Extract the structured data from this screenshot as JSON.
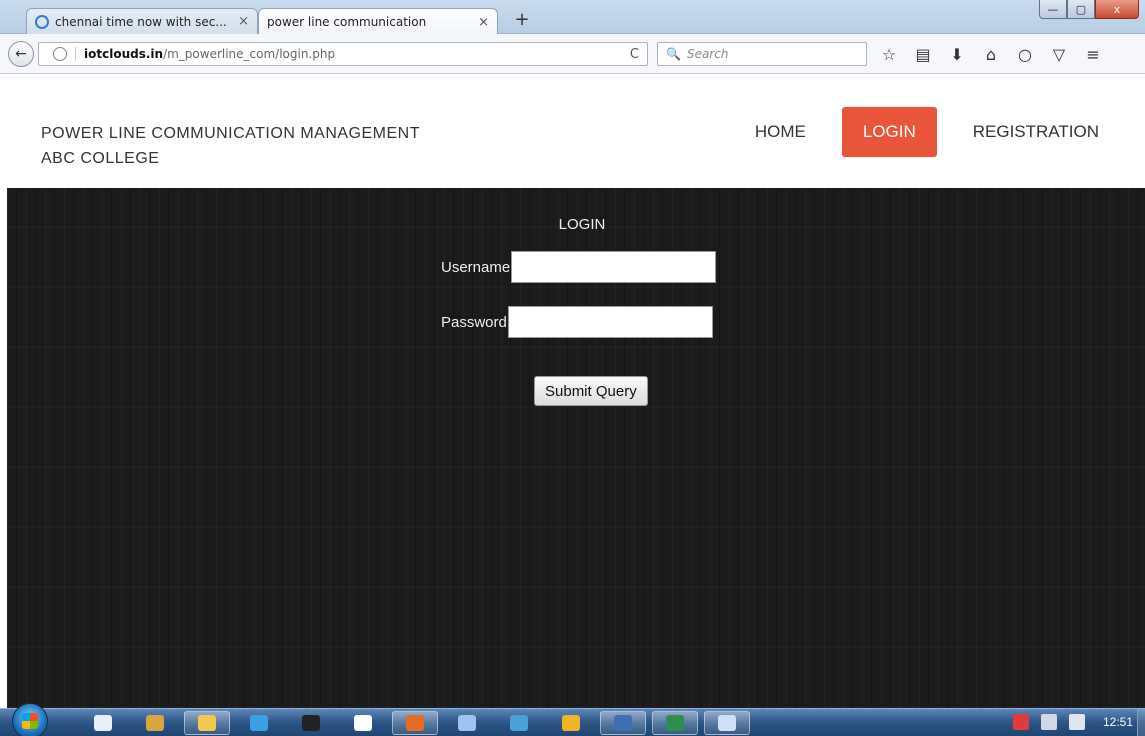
{
  "browser": {
    "tabs": [
      {
        "title": "chennai time now with sec...",
        "close": "×"
      },
      {
        "title": "power line communication",
        "close": "×"
      }
    ],
    "new_tab": "+",
    "window_controls": {
      "minimize": "—",
      "maximize": "▢",
      "close": "x"
    },
    "back": "←",
    "url_host": "iotclouds.in",
    "url_path": "/m_powerline_com/login.php",
    "reload": "C",
    "search_placeholder": "Search",
    "search_icon": "🔍",
    "toolbar_icons": [
      "star-icon",
      "reading-list-icon",
      "download-icon",
      "home-icon",
      "chat-icon",
      "pocket-icon",
      "menu-icon"
    ],
    "toolbar_glyphs": [
      "☆",
      "▤",
      "⬇",
      "⌂",
      "○",
      "▽",
      "≡"
    ]
  },
  "site": {
    "title_line1": "POWER LINE COMMUNICATION MANAGEMENT",
    "title_line2": "ABC COLLEGE",
    "nav": [
      {
        "label": "HOME",
        "active": false
      },
      {
        "label": "LOGIN",
        "active": true
      },
      {
        "label": "REGISTRATION",
        "active": false
      }
    ],
    "accent_color": "#e8553b"
  },
  "login_form": {
    "heading": "LOGIN",
    "username_label": "Username",
    "username_value": "",
    "password_label": "Password",
    "password_value": "",
    "submit_label": "Submit Query"
  },
  "taskbar": {
    "items": [
      {
        "name": "start-button"
      },
      {
        "name": "explorer-icon",
        "color": "#e8eef8"
      },
      {
        "name": "package-icon",
        "color": "#d9a441"
      },
      {
        "name": "folder-icon",
        "color": "#f2c94c",
        "open": true
      },
      {
        "name": "ie-icon",
        "color": "#3aa0e6"
      },
      {
        "name": "pen-icon",
        "color": "#222222"
      },
      {
        "name": "word-icon",
        "color": "#ffffff"
      },
      {
        "name": "firefox-icon",
        "color": "#e66a22",
        "open": true
      },
      {
        "name": "network-icon",
        "color": "#9ec3ee"
      },
      {
        "name": "app-icon",
        "color": "#4aa0d8"
      },
      {
        "name": "paint-icon",
        "color": "#f0b429"
      },
      {
        "name": "visio-icon",
        "color": "#3f6fb5",
        "open": true
      },
      {
        "name": "excel-icon",
        "color": "#2f8f4f",
        "open": true
      },
      {
        "name": "document-icon",
        "color": "#cfe0f5",
        "open": true
      }
    ],
    "tray": [
      "flag-icon",
      "network-tray-icon",
      "volume-muted-icon"
    ],
    "clock": "12:51"
  }
}
